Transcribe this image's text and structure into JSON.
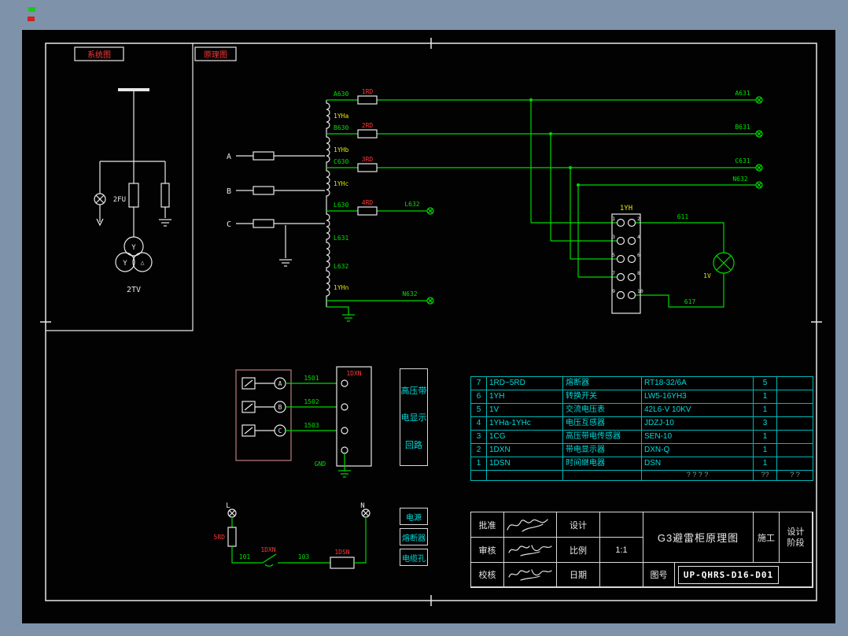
{
  "colors": {
    "backdrop": "#7e93a9",
    "canvas": "#020202",
    "frame": "#e8e8e8",
    "wire": "#00d800",
    "label_yellow": "#e6e600",
    "label_red": "#ff3838",
    "table_cyan": "#00dbdb"
  },
  "labels": {
    "system_view": "系统图",
    "schematic_view": "原理图"
  },
  "system": {
    "fuse": "2FU",
    "transformer": "2TV",
    "wye": "Y",
    "delta": "△"
  },
  "phases": {
    "a": "A",
    "b": "B",
    "c": "C"
  },
  "fuses": {
    "f1": "1RD",
    "f2": "2RD",
    "f3": "3RD",
    "f4": "4RD"
  },
  "nodes": {
    "a630": "A630",
    "b630": "B630",
    "c630": "C630",
    "l630": "L630",
    "l631": "L631",
    "l632": "L632",
    "l632_out": "L632",
    "n632": "N632",
    "a631": "A631",
    "b631": "B631",
    "c631": "C631",
    "n632_right": "N632",
    "w611": "611",
    "w617": "617",
    "n101": "101",
    "n103": "103"
  },
  "windings": {
    "a": "1YHa",
    "b": "1YHb",
    "c": "1YHc",
    "n": "1YHn"
  },
  "terminal_block": {
    "label": "1YH",
    "pins": [
      "1",
      "2",
      "3",
      "4",
      "5",
      "6",
      "7",
      "8",
      "9",
      "10"
    ]
  },
  "meter": {
    "label": "1V"
  },
  "display_circuit": {
    "box_label": "1DXN",
    "wires": [
      "1501",
      "1502",
      "1503"
    ],
    "phases": [
      "A",
      "B",
      "C"
    ],
    "gnd": "GND",
    "caption_lines": [
      "高压带",
      "电显示",
      "回路"
    ]
  },
  "ln_circuit": {
    "l": "L",
    "n": "N",
    "fuse": "5RD",
    "switch": "1DXN",
    "relay": "1DSN",
    "boxes": [
      "电源",
      "熔断器",
      "电缆孔"
    ]
  },
  "parts_table": {
    "rows": [
      {
        "no": "7",
        "ref": "1RD~5RD",
        "name": "熔断器",
        "model": "RT18-32/6A",
        "qty": "5",
        "note": ""
      },
      {
        "no": "6",
        "ref": "1YH",
        "name": "转换开关",
        "model": "LW5-16YH3",
        "qty": "1",
        "note": ""
      },
      {
        "no": "5",
        "ref": "1V",
        "name": "交流电压表",
        "model": "42L6-V 10KV",
        "qty": "1",
        "note": ""
      },
      {
        "no": "4",
        "ref": "1YHa-1YHc",
        "name": "电压互感器",
        "model": "JDZJ-10",
        "qty": "3",
        "note": ""
      },
      {
        "no": "3",
        "ref": "1CG",
        "name": "高压带电传感器",
        "model": "SEN-10",
        "qty": "1",
        "note": ""
      },
      {
        "no": "2",
        "ref": "1DXN",
        "name": "带电显示器",
        "model": "DXN-Q",
        "qty": "1",
        "note": ""
      },
      {
        "no": "1",
        "ref": "1DSN",
        "name": "时间继电器",
        "model": "DSN",
        "qty": "1",
        "note": ""
      }
    ],
    "footer": {
      "no": "",
      "ref": "",
      "name": "",
      "model": "? ? ? ?",
      "qty": "??",
      "note": "? ?"
    }
  },
  "title_block": {
    "approve": "批准",
    "review": "审核",
    "check": "校核",
    "design": "设计",
    "scale": "比例",
    "date": "日期",
    "scale_value": "1:1",
    "title": "G3避雷柜原理图",
    "stage_value": "施工",
    "stage_label_1": "设计",
    "stage_label_2": "阶段",
    "dwg_no_label": "图号",
    "dwg_no": "UP-QHRS-D16-D01"
  }
}
